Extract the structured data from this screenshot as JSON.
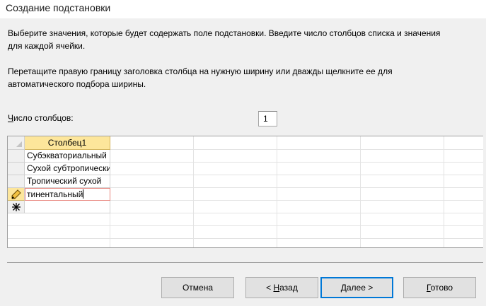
{
  "window": {
    "title": "Создание подстановки"
  },
  "instructions": {
    "line1": "Выберите значения, которые будет содержать поле подстановки. Введите число столбцов списка и значения",
    "line2": "для каждой ячейки.",
    "line3": "Перетащите правую границу заголовка столбца на нужную ширину или дважды щелкните ее для",
    "line4": "автоматического подбора ширины."
  },
  "columns_count": {
    "label_hotkey": "Ч",
    "label_rest": "исло столбцов:",
    "value": "1"
  },
  "grid": {
    "column_header": "Столбец1",
    "rows": [
      {
        "value": "Субэкваториальный"
      },
      {
        "value": "Сухой субтропический"
      },
      {
        "value": "Тропический сухой"
      },
      {
        "value": "тинентальный",
        "editing": true
      },
      {
        "value": "",
        "new_record": true
      }
    ],
    "edit_icon": "pencil-icon",
    "new_row_icon": "asterisk-icon"
  },
  "buttons": {
    "cancel": {
      "label": "Отмена"
    },
    "back": {
      "prefix": "< ",
      "hotkey": "Н",
      "rest": "азад"
    },
    "next": {
      "hotkey": "Д",
      "rest": "алее >"
    },
    "finish": {
      "hotkey": "Г",
      "rest": "отово"
    }
  },
  "colors": {
    "header_selected": "#fde69b",
    "default_button_border": "#0078d7",
    "editing_cell_border": "#e8847c"
  }
}
